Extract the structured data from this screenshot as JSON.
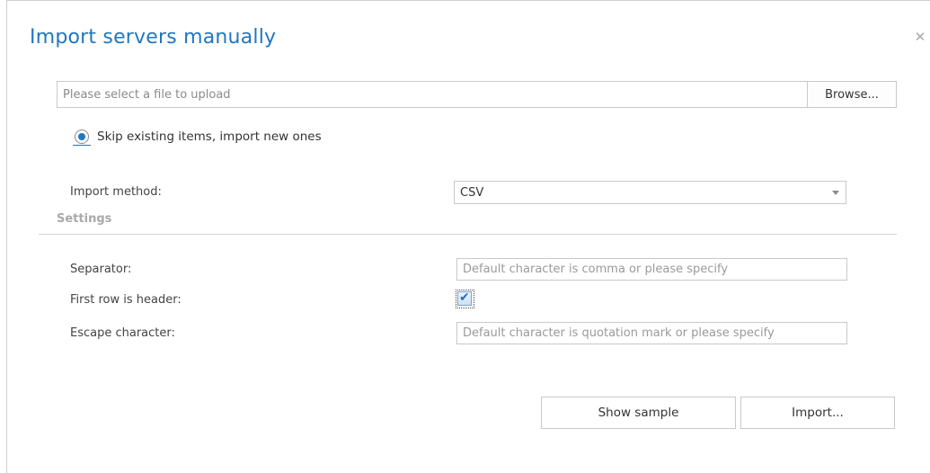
{
  "dialog": {
    "title": "Import servers manually",
    "close_icon": "close-icon"
  },
  "upload": {
    "placeholder": "Please select a file to upload",
    "value": "",
    "browse_label": "Browse..."
  },
  "import_mode": {
    "option_label": "Skip existing items, import new ones",
    "selected": true
  },
  "import_method": {
    "label": "Import method:",
    "value": "CSV"
  },
  "settings": {
    "heading": "Settings",
    "separator": {
      "label": "Separator:",
      "placeholder": "Default character is comma or please specify",
      "value": ""
    },
    "first_row_header": {
      "label": "First row is header:",
      "checked": true
    },
    "escape_character": {
      "label": "Escape character:",
      "placeholder": "Default character is quotation mark or please specify",
      "value": ""
    }
  },
  "actions": {
    "show_sample_label": "Show sample",
    "import_label": "Import..."
  },
  "colors": {
    "accent": "#1f77c0",
    "border": "#c9c9c9",
    "muted_heading": "#a9a9a9"
  }
}
